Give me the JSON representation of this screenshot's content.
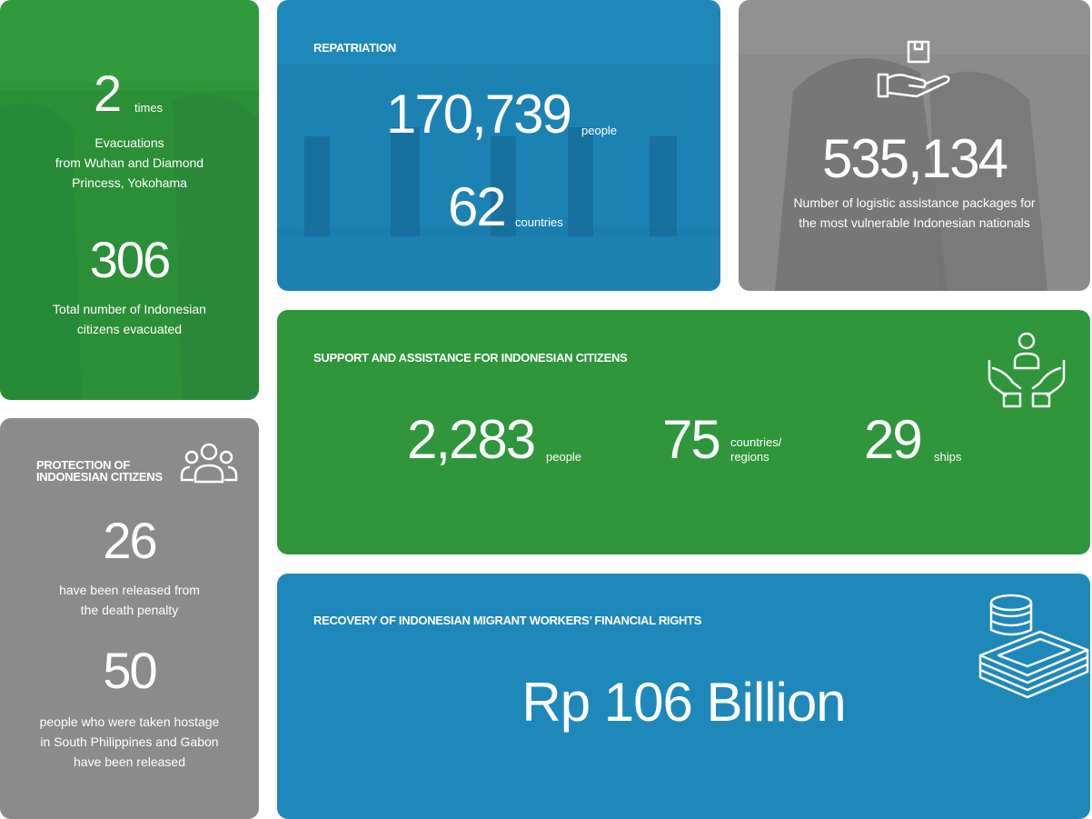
{
  "colors": {
    "green": "#2f963b",
    "blue": "#1f88bb",
    "grey": "#8b8b8b",
    "grey_dark": "#7a7a7a"
  },
  "evacuation": {
    "count": "2",
    "count_unit": "times",
    "count_desc_1": "Evacuations",
    "count_desc_2": "from Wuhan and Diamond",
    "count_desc_3": "Princess, Yokohama",
    "total": "306",
    "total_desc_1": "Total number of Indonesian",
    "total_desc_2": "citizens evacuated"
  },
  "repatriation": {
    "title": "REPATRIATION",
    "people": "170,739",
    "people_unit": "people",
    "countries": "62",
    "countries_unit": "countries"
  },
  "logistics": {
    "icon": "hand-package-icon",
    "value": "535,134",
    "desc_1": "Number of logistic assistance packages for",
    "desc_2": "the most vulnerable Indonesian nationals"
  },
  "protection": {
    "title_1": "PROTECTION OF",
    "title_2": "INDONESIAN CITIZENS",
    "icon": "group-people-icon",
    "released": "26",
    "released_desc_1": "have been released from",
    "released_desc_2": "the death penalty",
    "hostages": "50",
    "hostages_desc_1": "people who were taken hostage",
    "hostages_desc_2": "in South Philippines and Gabon",
    "hostages_desc_3": "have been released"
  },
  "support": {
    "title": "SUPPORT AND ASSISTANCE FOR INDONESIAN CITIZENS",
    "icon": "hands-care-person-icon",
    "people": "2,283",
    "people_unit": "people",
    "countries": "75",
    "countries_unit_1": "countries/",
    "countries_unit_2": "regions",
    "ships": "29",
    "ships_unit": "ships"
  },
  "financial": {
    "title": "RECOVERY OF INDONESIAN MIGRANT WORKERS’ FINANCIAL RIGHTS",
    "icon": "money-stack-icon",
    "value": "Rp 106 Billion"
  }
}
